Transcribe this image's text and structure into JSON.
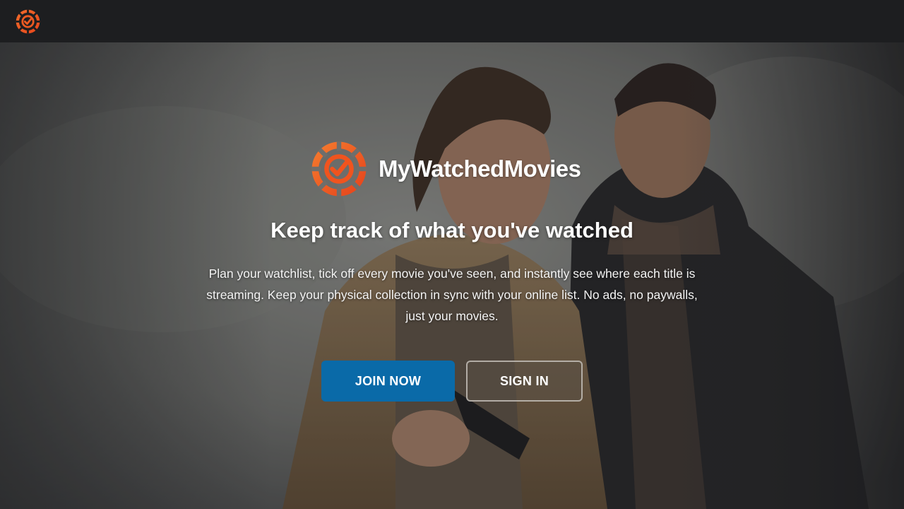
{
  "nav": {
    "logo_icon": "film-reel-check-icon",
    "logo_color": "#f0541e"
  },
  "hero": {
    "brand_name": "MyWatchedMovies",
    "headline": "Keep track of what you've watched",
    "tagline": "Plan your watchlist, tick off every movie you've seen, and instantly see where each title is streaming. Keep your physical collection in sync with your online list. No ads, no paywalls, just your movies.",
    "join_label": "JOIN NOW",
    "signin_label": "SIGN IN",
    "background": "movie-poster-two-men-image"
  },
  "colors": {
    "accent": "#f0541e",
    "join_button": "#0a6aa8",
    "topbar": "#1d1e20"
  }
}
